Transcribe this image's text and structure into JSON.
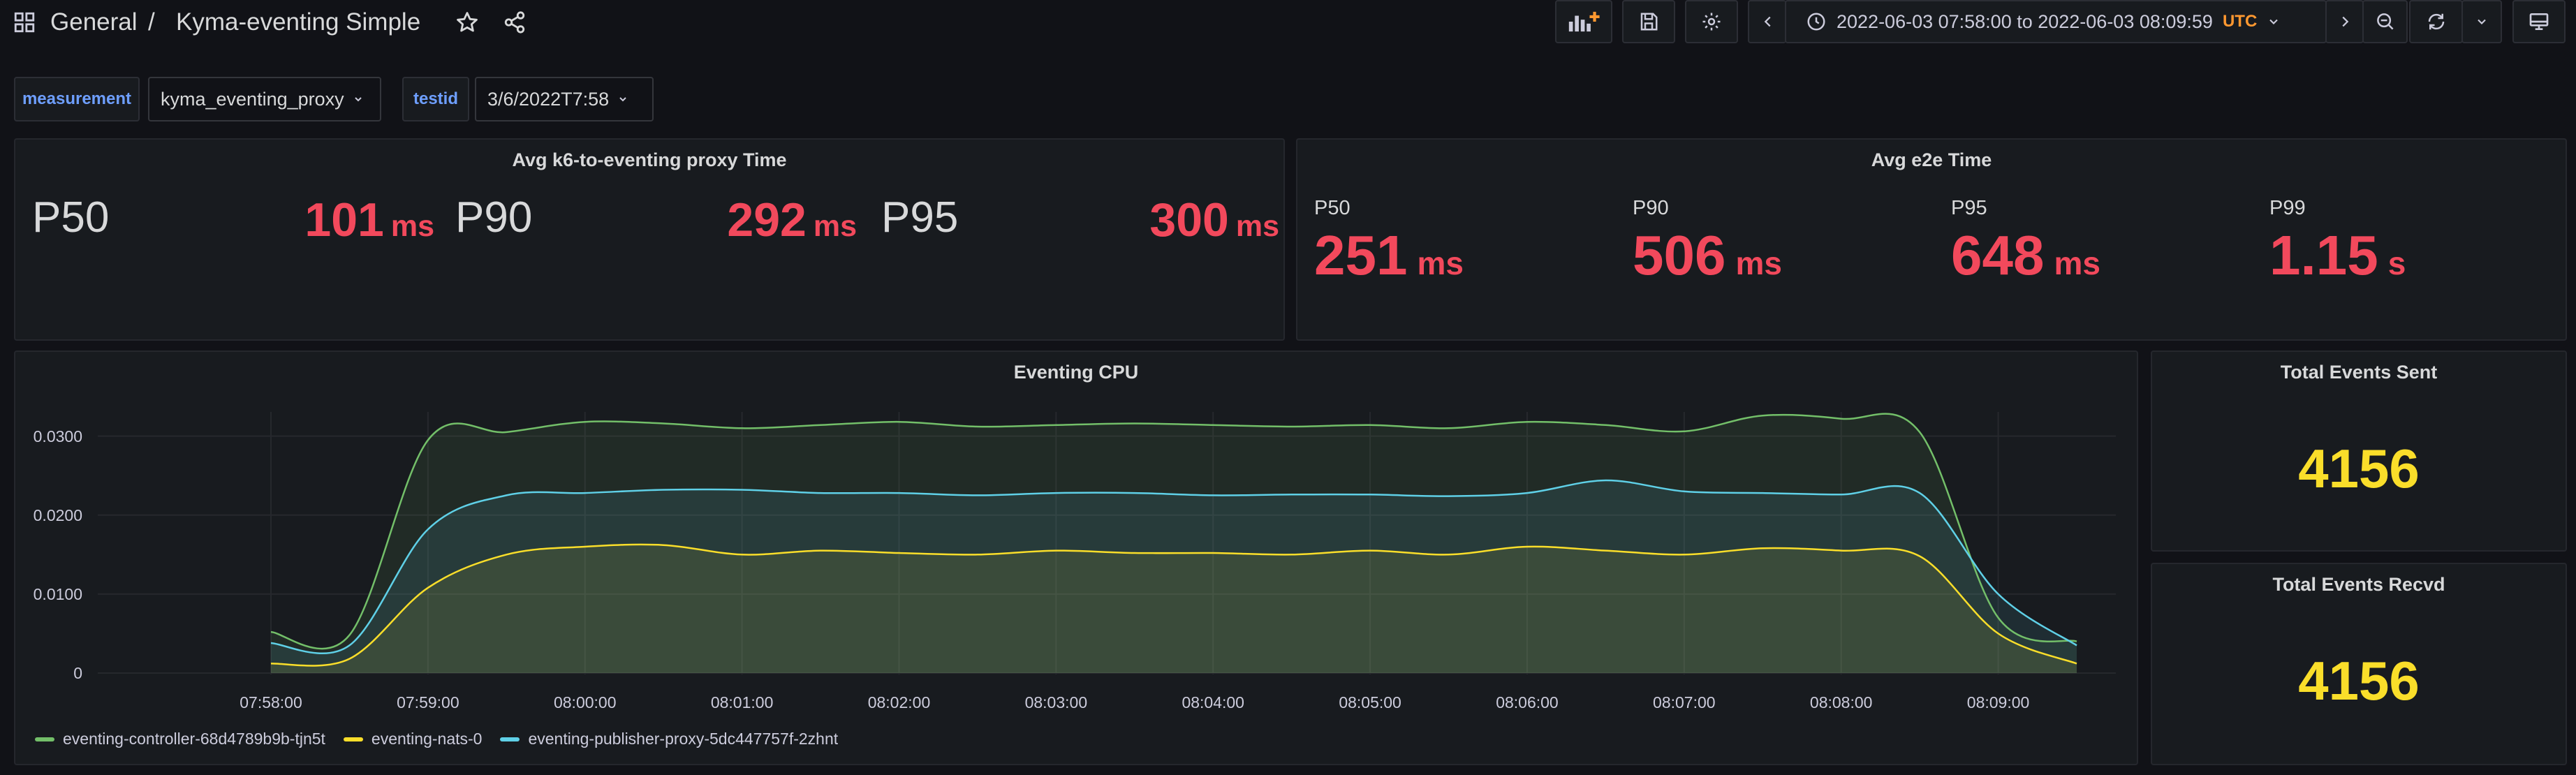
{
  "breadcrumb": {
    "folder": "General",
    "separator": "/",
    "dashboard": "Kyma-eventing Simple"
  },
  "time_range": {
    "text": "2022-06-03 07:58:00 to 2022-06-03 08:09:59",
    "timezone": "UTC"
  },
  "variables": [
    {
      "label": "measurement",
      "value": "kyma_eventing_proxy"
    },
    {
      "label": "testid",
      "value": "3/6/2022T7:58"
    }
  ],
  "panels": {
    "k6_proxy": {
      "title": "Avg k6-to-eventing proxy Time",
      "stats": [
        {
          "name": "P50",
          "value": "101",
          "unit": "ms"
        },
        {
          "name": "P90",
          "value": "292",
          "unit": "ms"
        },
        {
          "name": "P95",
          "value": "300",
          "unit": "ms"
        }
      ]
    },
    "e2e": {
      "title": "Avg e2e Time",
      "stats": [
        {
          "name": "P50",
          "value": "251",
          "unit": "ms"
        },
        {
          "name": "P90",
          "value": "506",
          "unit": "ms"
        },
        {
          "name": "P95",
          "value": "648",
          "unit": "ms"
        },
        {
          "name": "P99",
          "value": "1.15",
          "unit": "s"
        }
      ]
    },
    "total_sent": {
      "title": "Total Events Sent",
      "value": "4156"
    },
    "total_recvd": {
      "title": "Total Events Recvd",
      "value": "4156"
    }
  },
  "chart_data": {
    "type": "area",
    "title": "Eventing CPU",
    "x": [
      "07:58:00",
      "07:58:30",
      "07:59:00",
      "07:59:30",
      "08:00:00",
      "08:00:30",
      "08:01:00",
      "08:01:30",
      "08:02:00",
      "08:02:30",
      "08:03:00",
      "08:03:30",
      "08:04:00",
      "08:04:30",
      "08:05:00",
      "08:05:30",
      "08:06:00",
      "08:06:30",
      "08:07:00",
      "08:07:30",
      "08:08:00",
      "08:08:30",
      "08:09:00",
      "08:09:30"
    ],
    "x_ticks": [
      "07:58:00",
      "07:59:00",
      "08:00:00",
      "08:01:00",
      "08:02:00",
      "08:03:00",
      "08:04:00",
      "08:05:00",
      "08:06:00",
      "08:07:00",
      "08:08:00",
      "08:09:00"
    ],
    "y_ticks": [
      "0",
      "0.0100",
      "0.0200",
      "0.0300"
    ],
    "ylim": [
      0,
      0.0335
    ],
    "series": [
      {
        "name": "eventing-controller-68d4789b9b-tjn5t",
        "color": "#73bf69",
        "values": [
          0.0052,
          0.0048,
          0.0295,
          0.0305,
          0.0318,
          0.0316,
          0.031,
          0.0314,
          0.0318,
          0.0312,
          0.0314,
          0.0316,
          0.0314,
          0.0312,
          0.0314,
          0.031,
          0.0318,
          0.0314,
          0.0306,
          0.0326,
          0.0322,
          0.0305,
          0.007,
          0.004
        ]
      },
      {
        "name": "eventing-nats-0",
        "color": "#fade2a",
        "values": [
          0.0012,
          0.0018,
          0.0108,
          0.015,
          0.016,
          0.0162,
          0.015,
          0.0155,
          0.0152,
          0.015,
          0.0155,
          0.0152,
          0.0152,
          0.015,
          0.0155,
          0.015,
          0.016,
          0.0155,
          0.015,
          0.0158,
          0.0155,
          0.0148,
          0.005,
          0.0012
        ]
      },
      {
        "name": "eventing-publisher-proxy-5dc447757f-2zhnt",
        "color": "#5fd0e7",
        "values": [
          0.0038,
          0.0035,
          0.0182,
          0.0225,
          0.0228,
          0.0232,
          0.0232,
          0.0228,
          0.0228,
          0.0225,
          0.0228,
          0.0228,
          0.0225,
          0.0226,
          0.0226,
          0.0224,
          0.0228,
          0.0244,
          0.023,
          0.0228,
          0.0226,
          0.0228,
          0.01,
          0.0035
        ]
      }
    ],
    "legend_position": "bottom-left",
    "grid": true
  }
}
